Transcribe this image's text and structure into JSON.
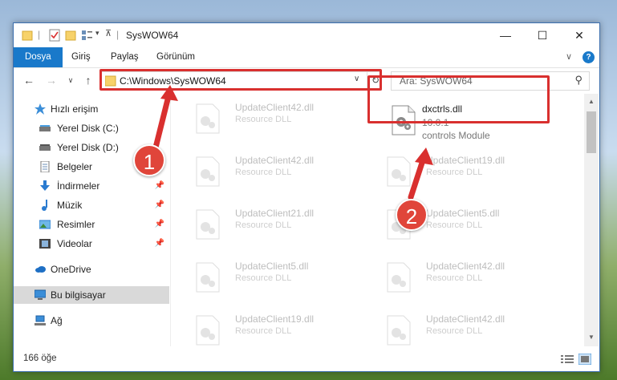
{
  "window": {
    "title": "SysWOW64",
    "minimize_icon": "—",
    "maximize_icon": "☐",
    "close_icon": "✕"
  },
  "ribbon": {
    "tabs": [
      {
        "label": "Dosya",
        "active": true
      },
      {
        "label": "Giriş",
        "active": false
      },
      {
        "label": "Paylaş",
        "active": false
      },
      {
        "label": "Görünüm",
        "active": false
      }
    ],
    "expand_icon": "∨",
    "help_icon": "?"
  },
  "address": {
    "path": "C:\\Windows\\SysWOW64",
    "dropdown_icon": "∨",
    "refresh_icon": "↻"
  },
  "search": {
    "placeholder": "Ara: SysWOW64",
    "icon": "⚲"
  },
  "sidebar": {
    "items": [
      {
        "label": "Hızlı erişim",
        "icon": "star-icon"
      },
      {
        "label": "Yerel Disk (C:)",
        "icon": "drive-icon",
        "pinned": true
      },
      {
        "label": "Yerel Disk (D:)",
        "icon": "drive-icon",
        "pinned": true
      },
      {
        "label": "Belgeler",
        "icon": "documents-icon",
        "pinned": true
      },
      {
        "label": "İndirmeler",
        "icon": "download-icon",
        "pinned": true
      },
      {
        "label": "Müzik",
        "icon": "music-icon",
        "pinned": true
      },
      {
        "label": "Resimler",
        "icon": "pictures-icon",
        "pinned": true
      },
      {
        "label": "Videolar",
        "icon": "videos-icon",
        "pinned": true
      },
      {
        "label": "OneDrive",
        "icon": "cloud-icon"
      },
      {
        "label": "Bu bilgisayar",
        "icon": "computer-icon",
        "selected": true
      },
      {
        "label": "Ağ",
        "icon": "network-icon"
      }
    ]
  },
  "files": {
    "selected": {
      "name": "dxctrls.dll",
      "version": "10.0.1",
      "description": "controls Module"
    },
    "left_column": [
      {
        "name": "UpdateClient42.dll",
        "desc": "Resource DLL"
      },
      {
        "name": "UpdateClient42.dll",
        "desc": "Resource DLL"
      },
      {
        "name": "UpdateClient21.dll",
        "desc": "Resource DLL"
      },
      {
        "name": "UpdateClient5.dll",
        "desc": "Resource DLL"
      },
      {
        "name": "UpdateClient19.dll",
        "desc": "Resource DLL"
      }
    ],
    "right_column": [
      {
        "name": "UpdateClient19.dll",
        "desc": "Resource DLL"
      },
      {
        "name": "UpdateClient5.dll",
        "desc": "Resource DLL"
      },
      {
        "name": "UpdateClient42.dll",
        "desc": "Resource DLL"
      },
      {
        "name": "UpdateClient42.dll",
        "desc": "Resource DLL"
      }
    ]
  },
  "status": {
    "count_text": "166 öğe"
  },
  "callouts": {
    "step1": "1",
    "step2": "2",
    "accent_color": "#d9302f"
  }
}
